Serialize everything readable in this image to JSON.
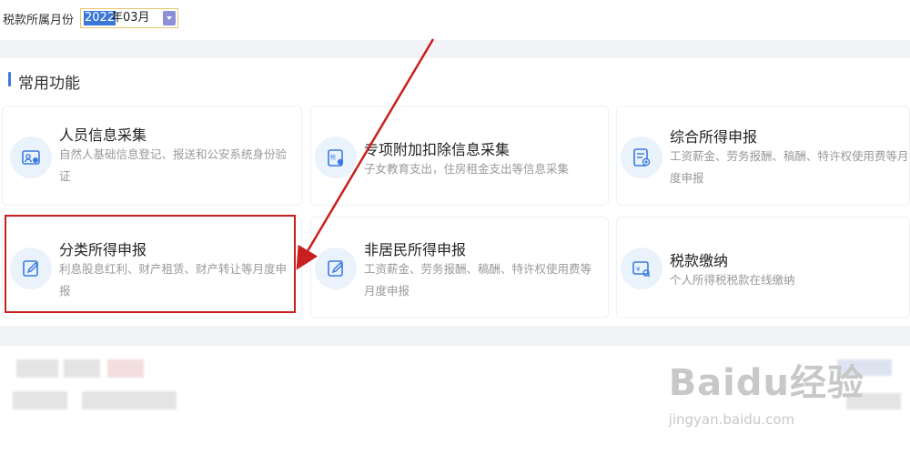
{
  "filter": {
    "month_label": "税款所属月份",
    "month_year_selected": "2022",
    "month_rest": "年03月"
  },
  "section": {
    "title": "常用功能"
  },
  "cards": [
    {
      "title": "人员信息采集",
      "desc": "自然人基础信息登记、报送和公安系统身份验证",
      "icon": "person-id-icon"
    },
    {
      "title": "专项附加扣除信息采集",
      "desc": "子女教育支出，住房租金支出等信息采集",
      "icon": "tax-form-icon"
    },
    {
      "title": "综合所得申报",
      "desc": "工资薪金、劳务报酬、稿酬、特许权使用费等月度申报",
      "icon": "document-add-icon"
    },
    {
      "title": "分类所得申报",
      "desc": "利息股息红利、财产租赁、财产转让等月度申报",
      "icon": "edit-icon"
    },
    {
      "title": "非居民所得申报",
      "desc": "工资薪金、劳务报酬、稿酬、特许权使用费等月度申报",
      "icon": "edit-icon"
    },
    {
      "title": "税款缴纳",
      "desc": "个人所得税税款在线缴纳",
      "icon": "payment-icon"
    }
  ],
  "watermark": {
    "logo": "Baidu经验",
    "url": "jingyan.baidu.com"
  },
  "colors": {
    "accent": "#3b7be0",
    "highlight": "#c9201f",
    "arrow": "#c9201f"
  }
}
